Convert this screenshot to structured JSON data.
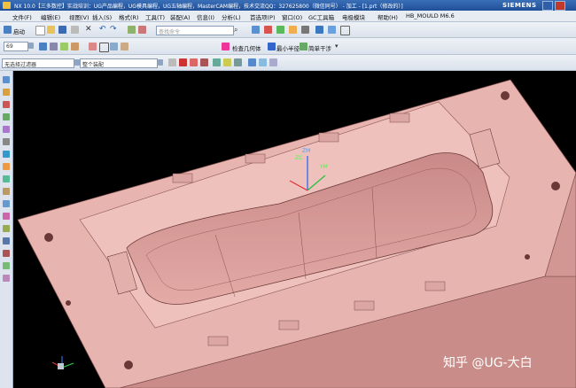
{
  "window": {
    "title": "NX 10.0【三多数控】实战培训：UG产品编程，UG模具编程，UG五轴编程，MasterCAM编程，技术交流QQ：327625800（微信同号） - 加工 - [1.prt（修改的）]",
    "brand": "SIEMENS"
  },
  "menu": {
    "items": [
      "文件(F)",
      "编辑(E)",
      "视图(V)",
      "插入(S)",
      "格式(R)",
      "工具(T)",
      "装配(A)",
      "信息(I)",
      "分析(L)",
      "首选项(P)",
      "窗口(O)",
      "GC工具箱",
      "电极模块",
      "帮助(H)",
      "HB_MOULD M6.6"
    ]
  },
  "toolbar1": {
    "start_label": "启动",
    "search_placeholder": "查找命令"
  },
  "toolbar2": {
    "zoom_value": "69",
    "check_geometry_label": "检查几何体",
    "min_radius_label": "最小半径",
    "simple_interference_label": "简单干涉"
  },
  "toolbar3": {
    "filter_value": "无选择过滤器",
    "assembly_scope_value": "整个装配"
  },
  "triad": {
    "zc": "ZC",
    "zm": "ZM",
    "ym": "YM"
  },
  "watermark": "知乎 @UG-大白",
  "colors": {
    "mold_face": "#e8b4b0",
    "mold_side": "#d79e99",
    "cavity": "#d49491",
    "viewport_bg": "#000000"
  }
}
